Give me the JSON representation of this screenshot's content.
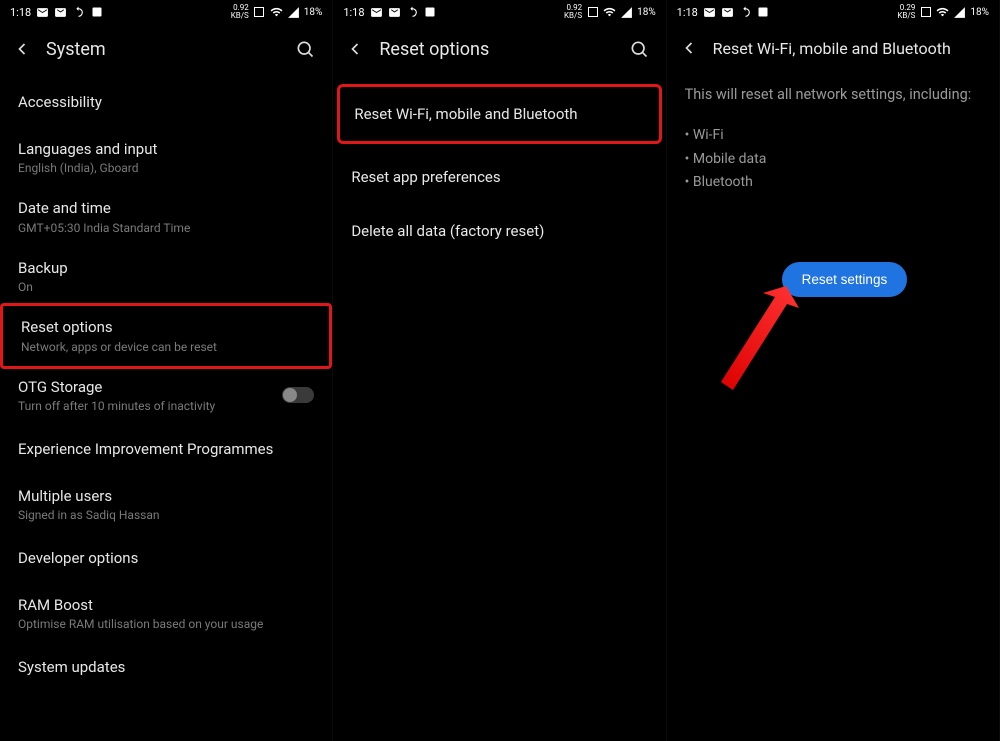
{
  "panel1": {
    "status": {
      "time": "1:18",
      "rate": "0.92",
      "rate_unit": "KB/S",
      "battery": "18%"
    },
    "title": "System",
    "items": [
      {
        "title": "Accessibility",
        "sub": ""
      },
      {
        "title": "Languages and input",
        "sub": "English (India), Gboard"
      },
      {
        "title": "Date and time",
        "sub": "GMT+05:30 India Standard Time"
      },
      {
        "title": "Backup",
        "sub": "On"
      },
      {
        "title": "Reset options",
        "sub": "Network, apps or device can be reset",
        "highlight": true
      },
      {
        "title": "OTG Storage",
        "sub": "Turn off after 10 minutes of inactivity",
        "toggle": true
      },
      {
        "title": "Experience Improvement Programmes",
        "sub": ""
      },
      {
        "title": "Multiple users",
        "sub": "Signed in as Sadiq Hassan"
      },
      {
        "title": "Developer options",
        "sub": ""
      },
      {
        "title": "RAM Boost",
        "sub": "Optimise RAM utilisation based on your usage"
      },
      {
        "title": "System updates",
        "sub": ""
      }
    ]
  },
  "panel2": {
    "status": {
      "time": "1:18",
      "rate": "0.92",
      "rate_unit": "KB/S",
      "battery": "18%"
    },
    "title": "Reset options",
    "items": [
      {
        "title": "Reset Wi-Fi, mobile and Bluetooth",
        "highlight": true
      },
      {
        "title": "Reset app preferences"
      },
      {
        "title": "Delete all data (factory reset)"
      }
    ]
  },
  "panel3": {
    "status": {
      "time": "1:18",
      "rate": "0.29",
      "rate_unit": "KB/S",
      "battery": "18%"
    },
    "title": "Reset Wi-Fi, mobile and Bluetooth",
    "info": "This will reset all network settings, including:",
    "bullets": [
      "Wi-Fi",
      "Mobile data",
      "Bluetooth"
    ],
    "button": "Reset settings"
  }
}
